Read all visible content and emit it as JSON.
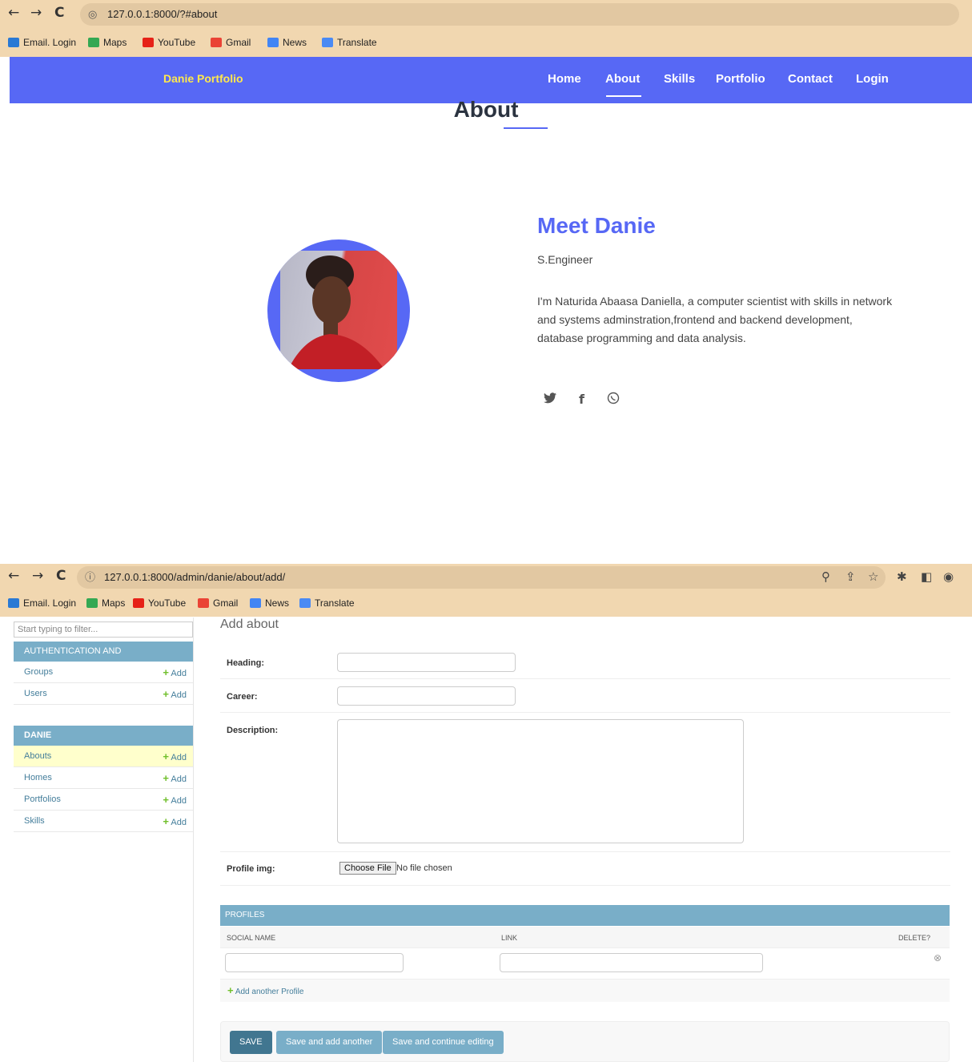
{
  "browser_top": {
    "url": "127.0.0.1:8000/?#about",
    "bookmarks": [
      "Email. Login",
      "Maps",
      "YouTube",
      "Gmail",
      "News",
      "Translate"
    ]
  },
  "portfolio": {
    "brand": "Danie Portfolio",
    "nav": [
      "Home",
      "About",
      "Skills",
      "Portfolio",
      "Contact",
      "Login"
    ],
    "active_nav": "About",
    "section_title": "About",
    "heading": "Meet Danie",
    "career": "S.Engineer",
    "description": "I'm Naturida Abaasa Daniella, a computer scientist with skills in network and systems adminstration,frontend and backend development, database programming and data analysis.",
    "social_icons": [
      "twitter-icon",
      "facebook-icon",
      "whatsapp-icon"
    ]
  },
  "browser_bottom": {
    "url": "127.0.0.1:8000/admin/danie/about/add/",
    "bookmarks": [
      "Email. Login",
      "Maps",
      "YouTube",
      "Gmail",
      "News",
      "Translate"
    ]
  },
  "admin": {
    "filter_placeholder": "Start typing to filter...",
    "auth_section": "AUTHENTICATION AND AUTHORIZATION",
    "auth_models": [
      {
        "label": "Groups",
        "add": "Add"
      },
      {
        "label": "Users",
        "add": "Add"
      }
    ],
    "app_section": "DANIE",
    "app_models": [
      {
        "label": "Abouts",
        "add": "Add"
      },
      {
        "label": "Homes",
        "add": "Add"
      },
      {
        "label": "Portfolios",
        "add": "Add"
      },
      {
        "label": "Skills",
        "add": "Add"
      }
    ],
    "page_title": "Add about",
    "fields": {
      "heading": "Heading:",
      "career": "Career:",
      "description": "Description:",
      "profile_img": "Profile img:",
      "choose_file": "Choose File",
      "no_file": "No file chosen"
    },
    "inline": {
      "title": "PROFILES",
      "col_social": "SOCIAL NAME",
      "col_link": "LINK",
      "col_delete": "DELETE?",
      "add_another": "Add another Profile"
    },
    "buttons": {
      "save": "SAVE",
      "save_add": "Save and add another",
      "save_continue": "Save and continue editing"
    },
    "colors": {
      "header": "#79aec8",
      "link": "#447e9b",
      "add_plus": "#70bf2b",
      "save": "#417690",
      "secondary": "#79aec8"
    }
  }
}
